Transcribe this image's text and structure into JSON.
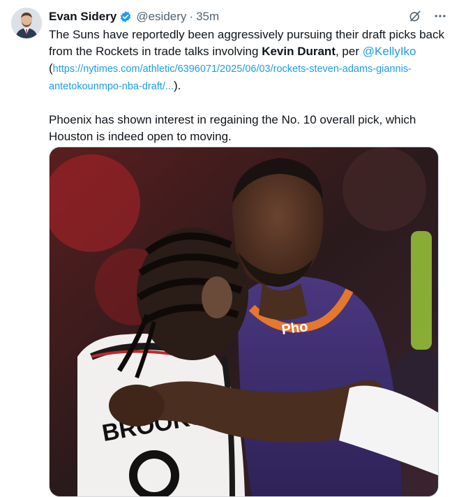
{
  "tweet": {
    "author_name": "Evan Sidery",
    "author_handle": "@esidery",
    "separator": "·",
    "timestamp": "35m",
    "icons": [
      "verified-badge-icon",
      "grok-icon",
      "more-icon"
    ],
    "text_p1_a": "The Suns have reportedly been aggressively pursuing their draft picks back from the Rockets in trade talks involving ",
    "text_p1_bold": "Kevin Durant",
    "text_p1_b": ", per ",
    "mention": "@KellyIko",
    "paren_open": "(",
    "url": "https://nytimes.com/athletic/6396071/2025/06/03/rockets-steven-adams-giannis-antetokounmpo-nba-draft/...",
    "paren_close": ").",
    "text_p2": "Phoenix has shown interest in regaining the No. 10 overall pick, which Houston is indeed open to moving.",
    "media": {
      "jersey_text": "BROOKS",
      "logo_text": "Pho",
      "colors": {
        "suns_purple": "#3b2a6b",
        "suns_orange": "#e5772e",
        "rockets_white": "#f2f0ee",
        "rockets_red": "#c1272d"
      }
    }
  },
  "colors": {
    "link": "#1d9bf0",
    "secondary": "#536471",
    "verified": "#1d9bf0"
  }
}
